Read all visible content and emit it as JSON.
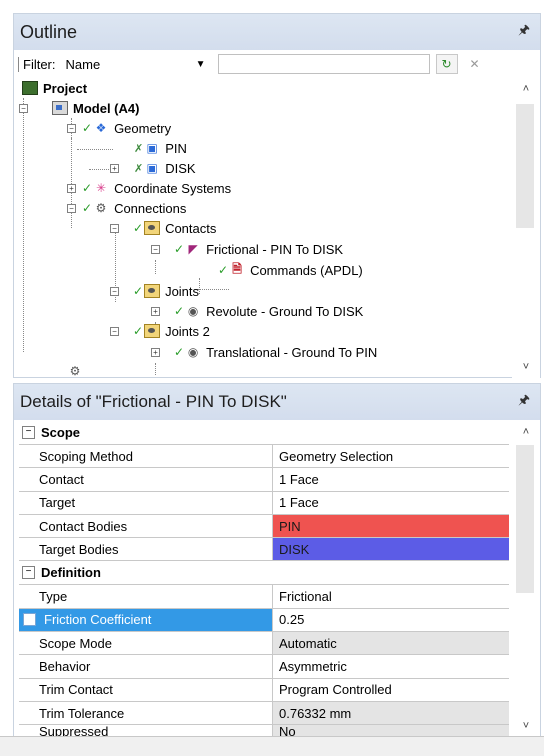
{
  "outline": {
    "title": "Outline",
    "filter_label": "Filter:",
    "filter_value": "Name",
    "tree": [
      {
        "label": "Project"
      },
      {
        "label": "Model (A4)"
      },
      {
        "label": "Geometry"
      },
      {
        "label": "PIN"
      },
      {
        "label": "DISK"
      },
      {
        "label": "Coordinate Systems"
      },
      {
        "label": "Connections"
      },
      {
        "label": "Contacts"
      },
      {
        "label": "Frictional - PIN To DISK"
      },
      {
        "label": "Commands (APDL)"
      },
      {
        "label": "Joints"
      },
      {
        "label": "Revolute - Ground To DISK"
      },
      {
        "label": "Joints 2"
      },
      {
        "label": "Translational - Ground To PIN"
      }
    ]
  },
  "details": {
    "title": "Details of \"Frictional - PIN To DISK\"",
    "groups": [
      {
        "name": "Scope",
        "rows": [
          {
            "name": "Scoping Method",
            "value": "Geometry Selection"
          },
          {
            "name": "Contact",
            "value": "1 Face"
          },
          {
            "name": "Target",
            "value": "1 Face"
          },
          {
            "name": "Contact Bodies",
            "value": "PIN"
          },
          {
            "name": "Target Bodies",
            "value": "DISK"
          }
        ]
      },
      {
        "name": "Definition",
        "rows": [
          {
            "name": "Type",
            "value": "Frictional"
          },
          {
            "name": "Friction Coefficient",
            "value": "0.25"
          },
          {
            "name": "Scope Mode",
            "value": "Automatic"
          },
          {
            "name": "Behavior",
            "value": "Asymmetric"
          },
          {
            "name": "Trim Contact",
            "value": "Program Controlled"
          },
          {
            "name": "Trim Tolerance",
            "value": "0.76332 mm"
          },
          {
            "name": "Suppressed",
            "value": "No"
          }
        ]
      }
    ]
  },
  "colors": {
    "contact_bodies": "#ef5350",
    "target_bodies": "#5c5ce6",
    "selection": "#3399e6",
    "header": "#d9e2ef"
  }
}
